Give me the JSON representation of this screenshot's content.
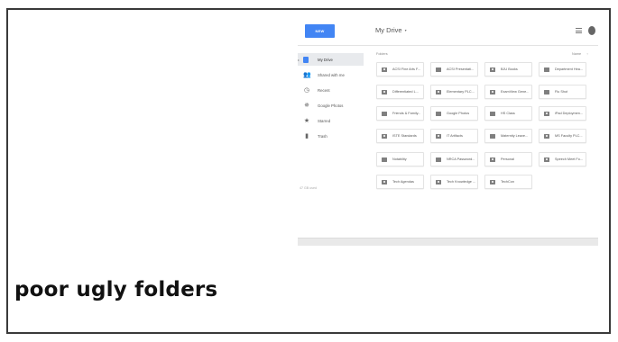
{
  "header": {
    "new_button": "NEW",
    "title": "My Drive",
    "title_caret": "▾",
    "list_view_icon": "list-view-icon",
    "info_icon": "info-icon"
  },
  "sidebar": {
    "items": [
      {
        "label": "My Drive",
        "icon": "drive-icon",
        "active": true
      },
      {
        "label": "Shared with me",
        "icon": "people-icon",
        "active": false
      },
      {
        "label": "Recent",
        "icon": "clock-icon",
        "active": false
      },
      {
        "label": "Google Photos",
        "icon": "pinwheel-icon",
        "active": false
      },
      {
        "label": "Starred",
        "icon": "star-icon",
        "active": false
      },
      {
        "label": "Trash",
        "icon": "trash-icon",
        "active": false
      }
    ],
    "storage": "47 GB used"
  },
  "content": {
    "section_label": "Folders",
    "sort_label": "Name",
    "sort_arrow": "↑",
    "folders": [
      {
        "name": "ACSI Fine Arts F...",
        "shared": true
      },
      {
        "name": "ACSI Presentati...",
        "shared": false
      },
      {
        "name": "BJU Books",
        "shared": true
      },
      {
        "name": "Department Hea...",
        "shared": false
      },
      {
        "name": "Differentiated L...",
        "shared": true
      },
      {
        "name": "Elementary PLC...",
        "shared": true
      },
      {
        "name": "ExamView Gene...",
        "shared": true
      },
      {
        "name": "Flu Shot",
        "shared": false
      },
      {
        "name": "Friends & Family...",
        "shared": false
      },
      {
        "name": "Google Photos",
        "shared": false
      },
      {
        "name": "HS Class",
        "shared": false
      },
      {
        "name": "iPad Deploymen...",
        "shared": true
      },
      {
        "name": "ISTE Standards",
        "shared": true
      },
      {
        "name": "IT Artifacts",
        "shared": true
      },
      {
        "name": "Maternity Leave...",
        "shared": false
      },
      {
        "name": "MS Faculty PLC...",
        "shared": true
      },
      {
        "name": "Notability",
        "shared": false
      },
      {
        "name": "NRCA Password...",
        "shared": false
      },
      {
        "name": "Personal",
        "shared": true
      },
      {
        "name": "Speech Meet Fo...",
        "shared": true
      },
      {
        "name": "Tech Agendas",
        "shared": true
      },
      {
        "name": "Tech Knowledge ...",
        "shared": true
      },
      {
        "name": "TechCon",
        "shared": true
      }
    ]
  },
  "caption": "poor ugly folders"
}
